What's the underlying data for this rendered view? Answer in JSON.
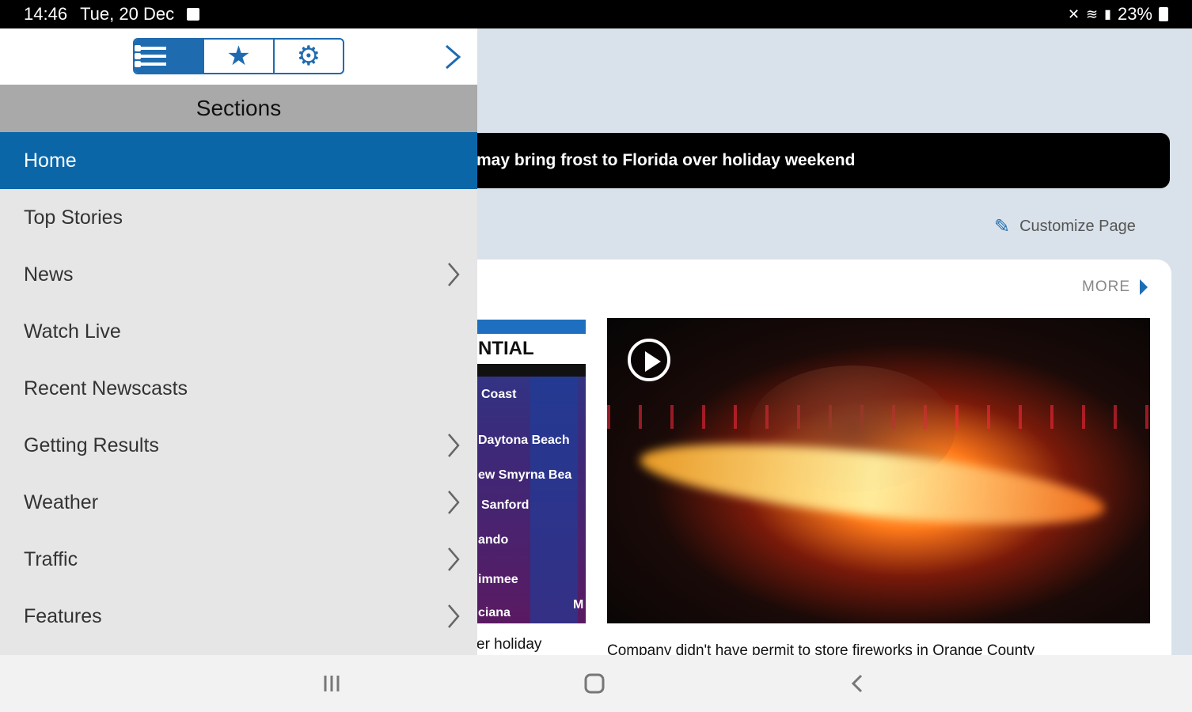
{
  "status_bar": {
    "time": "14:46",
    "date": "Tue, 20 Dec",
    "battery": "23%"
  },
  "drawer": {
    "title": "Sections",
    "tabs": [
      {
        "name": "list-icon",
        "active": true
      },
      {
        "name": "star-icon",
        "active": false
      },
      {
        "name": "gear-icon",
        "active": false
      }
    ],
    "items": [
      {
        "label": "Home",
        "active": true,
        "chevron": false
      },
      {
        "label": "Top Stories",
        "active": false,
        "chevron": false
      },
      {
        "label": "News",
        "active": false,
        "chevron": true
      },
      {
        "label": "Watch Live",
        "active": false,
        "chevron": false
      },
      {
        "label": "Recent Newscasts",
        "active": false,
        "chevron": false
      },
      {
        "label": "Getting Results",
        "active": false,
        "chevron": true
      },
      {
        "label": "Weather",
        "active": false,
        "chevron": true
      },
      {
        "label": "Traffic",
        "active": false,
        "chevron": true
      },
      {
        "label": "Features",
        "active": false,
        "chevron": true
      }
    ],
    "accent_color": "#0b66a8"
  },
  "main": {
    "ticker_text": "may bring frost to Florida over holiday weekend",
    "customize_label": "Customize Page",
    "more_label": "MORE",
    "map_thumb": {
      "heading": "NTIAL",
      "cities": [
        "Coast",
        "Daytona Beach",
        "ew Smyrna Bea",
        "Sanford",
        "ando",
        "immee",
        "ciana",
        "M"
      ]
    },
    "thumb_caption": "er holiday",
    "video_caption": "Company didn't have permit to store fireworks in Orange County"
  }
}
